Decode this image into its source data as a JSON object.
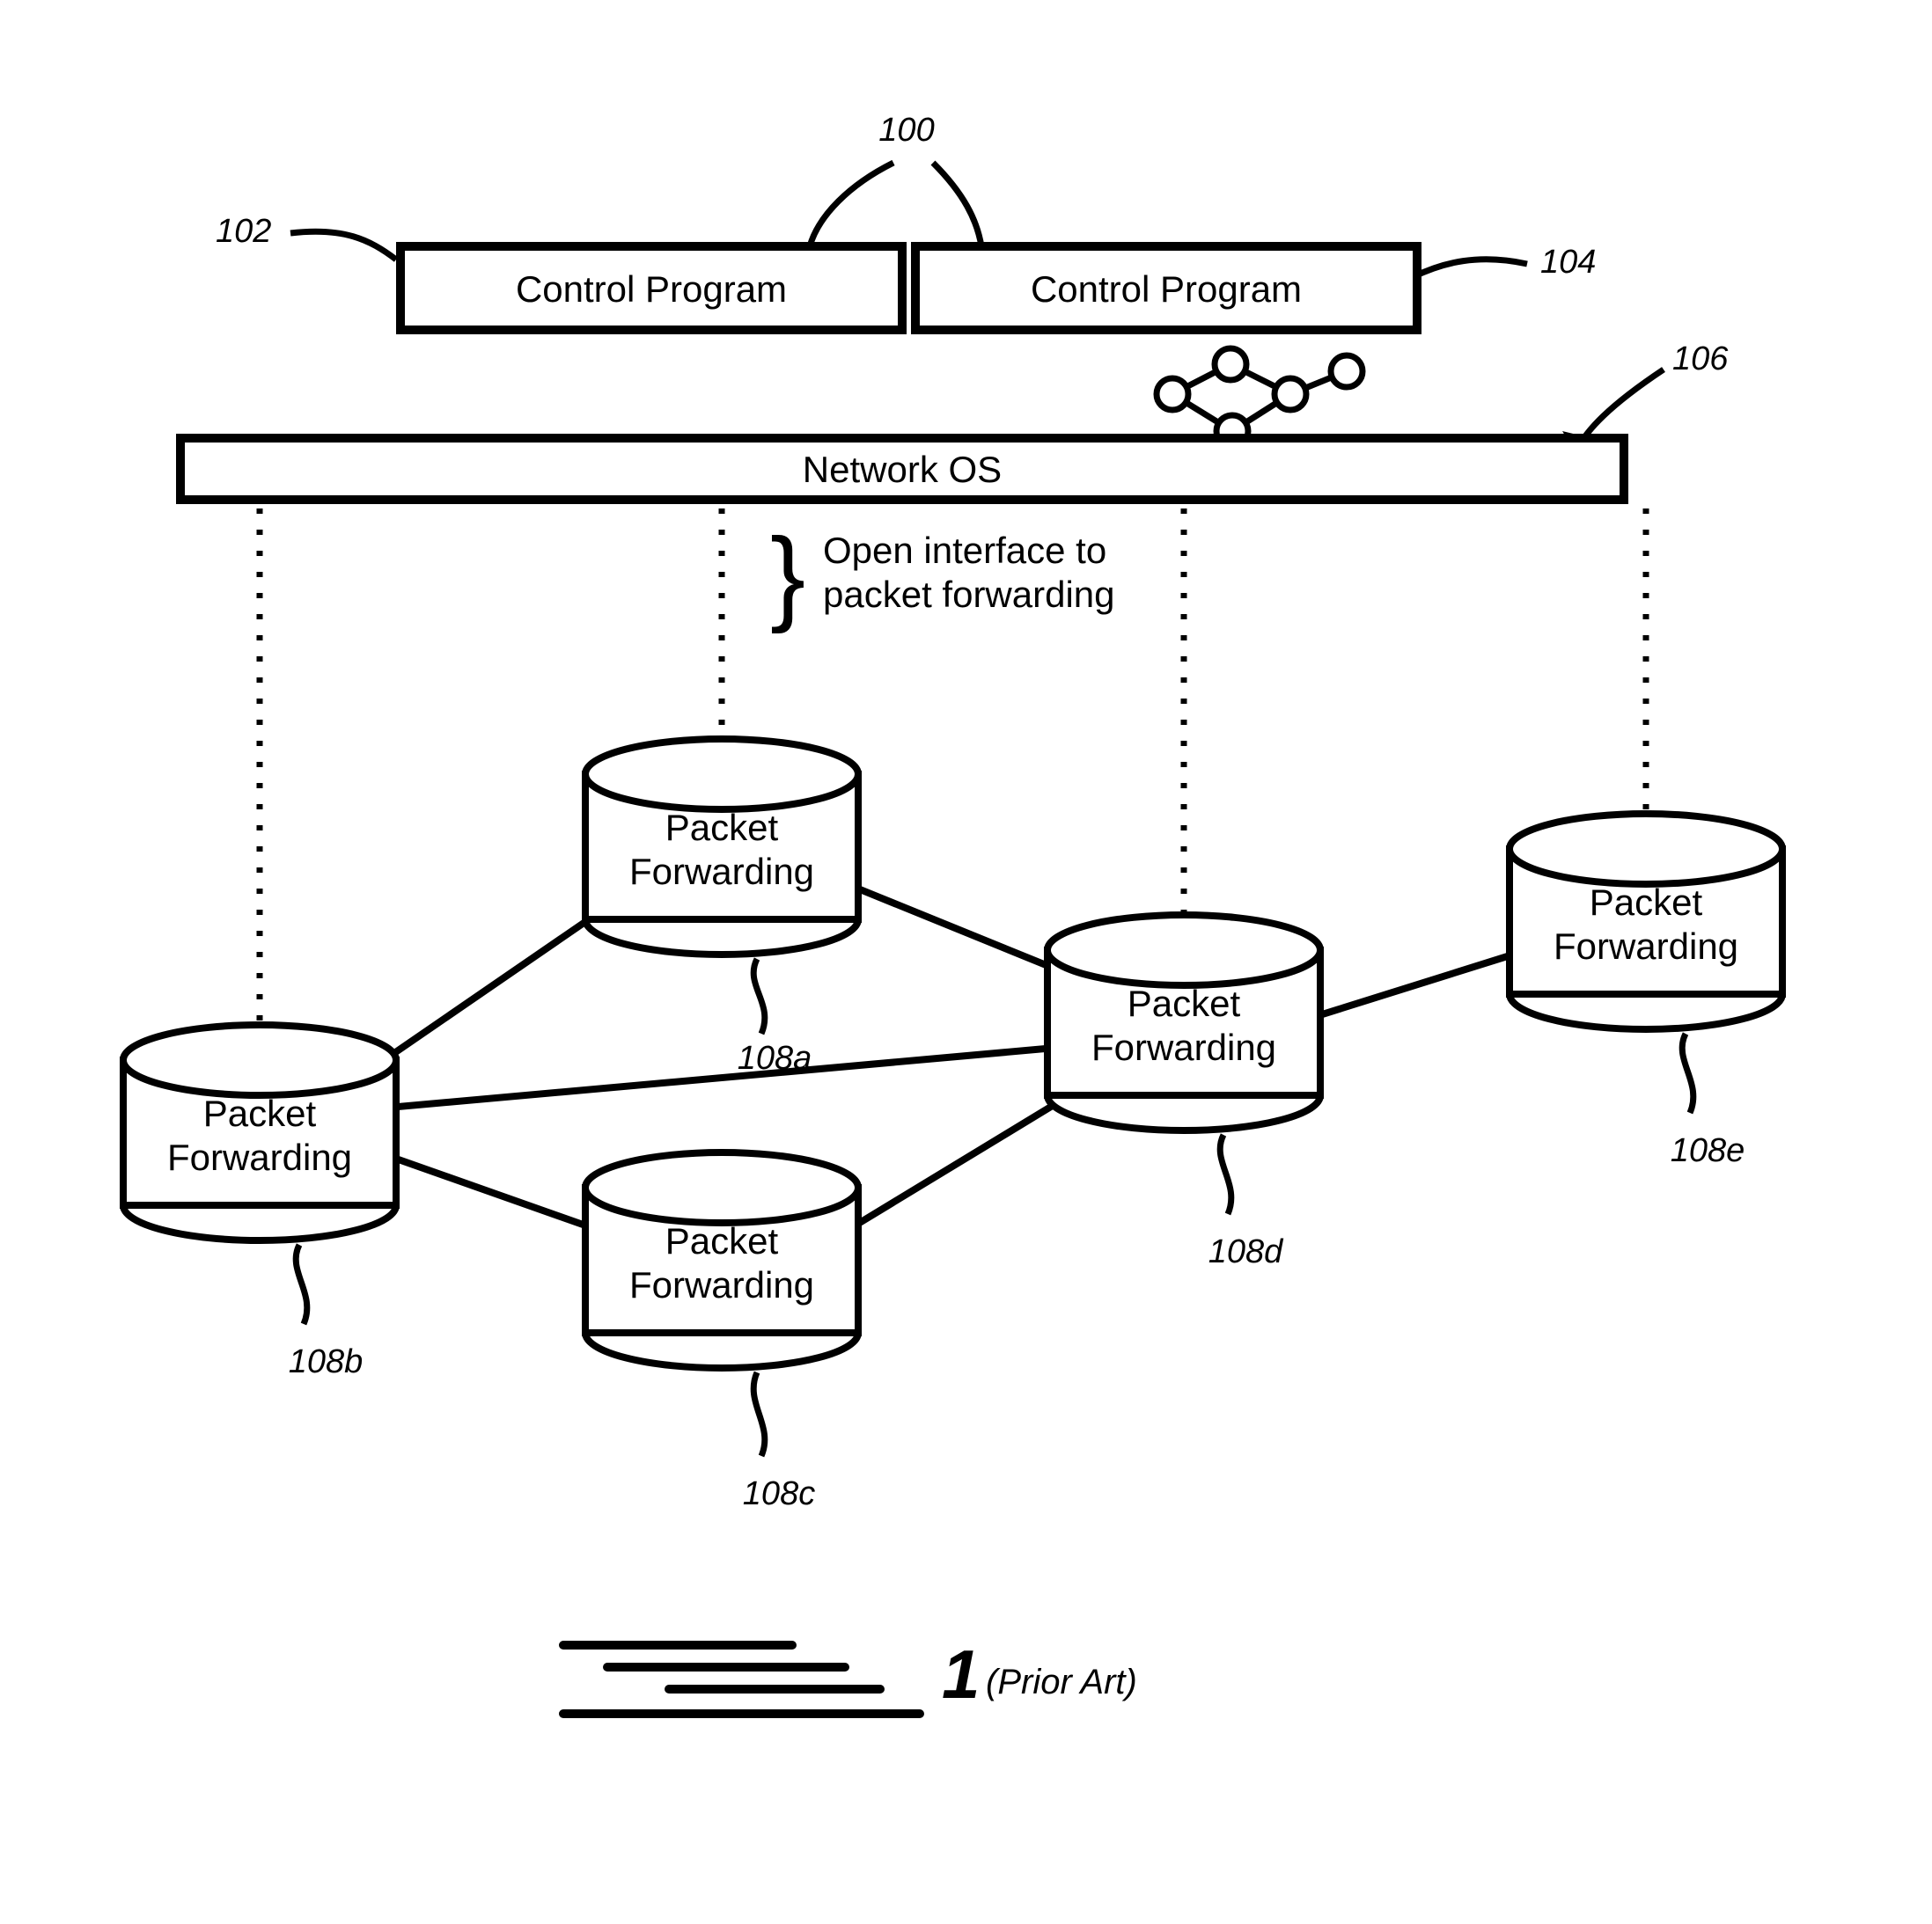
{
  "ref_numbers": {
    "top_center": "100",
    "cp_left": "102",
    "cp_right": "104",
    "nos": "106",
    "pf_a": "108a",
    "pf_b": "108b",
    "pf_c": "108c",
    "pf_d": "108d",
    "pf_e": "108e"
  },
  "boxes": {
    "cp_left": "Control Program",
    "cp_right": "Control Program",
    "nos": "Network OS"
  },
  "interface": {
    "line1": "Open interface to",
    "line2": "packet forwarding"
  },
  "pf": {
    "line1": "Packet",
    "line2": "Forwarding"
  },
  "caption_suffix": "(Prior Art)"
}
